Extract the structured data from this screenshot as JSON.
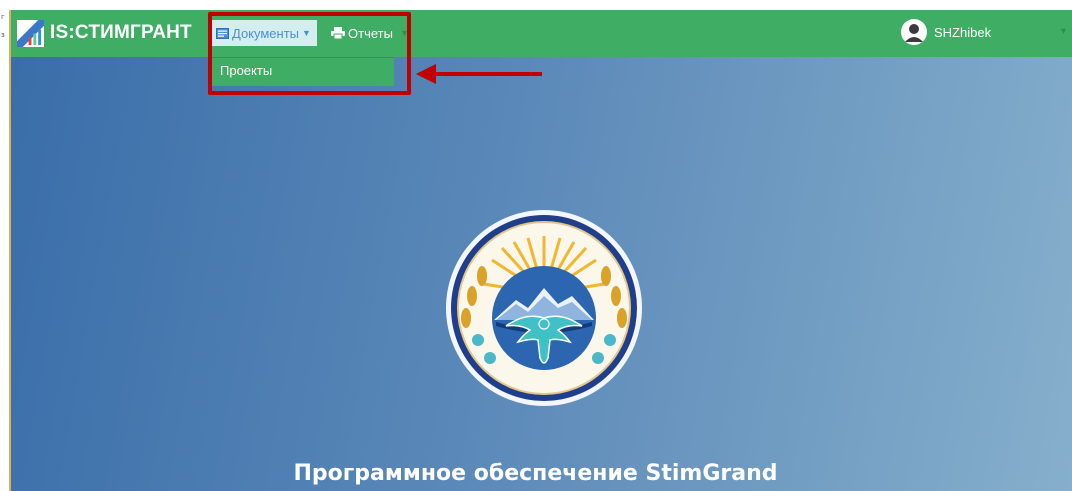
{
  "app": {
    "brand_name": "IS:СТИМГРАНТ"
  },
  "navbar": {
    "menu_documents": "Документы",
    "menu_reports": "Отчеты",
    "documents_dropdown": [
      "Проекты"
    ]
  },
  "user": {
    "username": "SHZhibek"
  },
  "hero": {
    "title": "Программное обеспечение StimGrand"
  },
  "stray_glyphs": [
    "г",
    "з"
  ],
  "colors": {
    "navbar": "#3fad63",
    "annotation": "#c00000",
    "hero_gradient_start": "#3a6ea9",
    "hero_gradient_end": "#86afcc"
  },
  "icons": [
    "brand-logo-icon",
    "document-icon",
    "caret-down-icon",
    "print-icon",
    "user-avatar-icon",
    "state-emblem"
  ]
}
